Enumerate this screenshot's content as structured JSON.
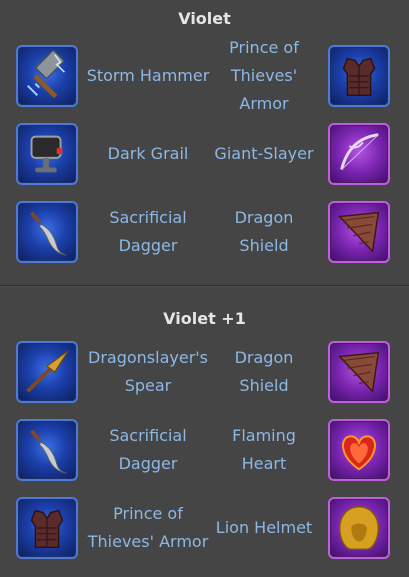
{
  "sections": [
    {
      "title": "Violet",
      "rows": [
        {
          "left": {
            "name": "Storm Hammer",
            "icon": "storm-hammer-icon",
            "frame": "blue"
          },
          "right": {
            "name": "Prince of Thieves' Armor",
            "icon": "armor-vest-icon",
            "frame": "blue"
          }
        },
        {
          "left": {
            "name": "Dark Grail",
            "icon": "grail-icon",
            "frame": "blue"
          },
          "right": {
            "name": "Giant-Slayer",
            "icon": "bow-icon",
            "frame": "purple"
          }
        },
        {
          "left": {
            "name": "Sacrificial Dagger",
            "icon": "dagger-icon",
            "frame": "blue"
          },
          "right": {
            "name": "Dragon Shield",
            "icon": "scale-shield-icon",
            "frame": "purple"
          }
        }
      ]
    },
    {
      "title": "Violet +1",
      "rows": [
        {
          "left": {
            "name": "Dragonslayer's Spear",
            "icon": "spear-icon",
            "frame": "blue"
          },
          "right": {
            "name": "Dragon Shield",
            "icon": "scale-shield-icon",
            "frame": "purple"
          }
        },
        {
          "left": {
            "name": "Sacrificial Dagger",
            "icon": "dagger-icon",
            "frame": "blue"
          },
          "right": {
            "name": "Flaming Heart",
            "icon": "flaming-heart-icon",
            "frame": "purple"
          }
        },
        {
          "left": {
            "name": "Prince of Thieves' Armor",
            "icon": "armor-vest-icon",
            "frame": "blue"
          },
          "right": {
            "name": "Lion Helmet",
            "icon": "lion-helmet-icon",
            "frame": "purple"
          }
        }
      ]
    }
  ]
}
